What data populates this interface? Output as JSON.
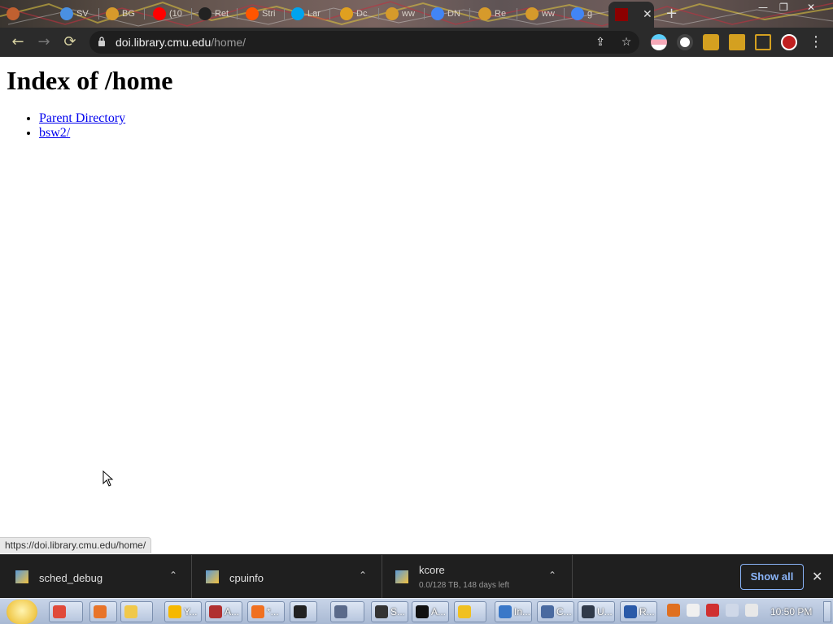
{
  "browser": {
    "tabs": [
      {
        "title": "SV",
        "icon": "circle-blue-icon",
        "color": "#4a90e2"
      },
      {
        "title": "BG",
        "icon": "circle-orange-icon",
        "color": "#d69a2b"
      },
      {
        "title": "(10",
        "icon": "youtube-icon",
        "color": "#ff0000"
      },
      {
        "title": "Ret",
        "icon": "github-icon",
        "color": "#222222"
      },
      {
        "title": "Stri",
        "icon": "soundcloud-icon",
        "color": "#ff5500"
      },
      {
        "title": "Lar",
        "icon": "microsoft-icon",
        "color": "#00a4ef"
      },
      {
        "title": "Dc",
        "icon": "circle-orange-icon",
        "color": "#e0a020"
      },
      {
        "title": "ww",
        "icon": "circle-orange-icon",
        "color": "#d69a2b"
      },
      {
        "title": "DN",
        "icon": "google-icon",
        "color": "#4285f4"
      },
      {
        "title": "Re",
        "icon": "circle-orange-icon",
        "color": "#d69a2b"
      },
      {
        "title": "ww",
        "icon": "circle-orange-icon",
        "color": "#d69a2b"
      },
      {
        "title": "g",
        "icon": "google-icon",
        "color": "#4285f4"
      }
    ],
    "active_tab": {
      "icon": "red-square-icon",
      "close": "✕"
    },
    "new_tab": "+",
    "window_controls": {
      "minimize": "—",
      "maximize": "❐",
      "close": "✕"
    },
    "nav": {
      "back": "←",
      "forward": "→",
      "reload": "⟳"
    },
    "url": {
      "host": "doi.library.cmu.edu",
      "path": "/home/"
    },
    "omnibox_icons": {
      "share": "⇪",
      "bookmark": "☆"
    },
    "menu": "⋮"
  },
  "page": {
    "heading": "Index of /home",
    "links": [
      {
        "label": "Parent Directory"
      },
      {
        "label": "bsw2/"
      }
    ],
    "status_url": "https://doi.library.cmu.edu/home/"
  },
  "downloads": {
    "items": [
      {
        "name": "sched_debug",
        "sub": ""
      },
      {
        "name": "cpuinfo",
        "sub": ""
      },
      {
        "name": "kcore",
        "sub": "0.0/128 TB, 148 days left"
      }
    ],
    "show_all": "Show all",
    "close": "✕",
    "chevron": "⌃"
  },
  "taskbar": {
    "tasks": [
      {
        "label": "",
        "icon": "chrome-icon",
        "color": "#e04a3a"
      },
      {
        "label": "",
        "icon": "firefox-icon",
        "color": "#e8742a"
      },
      {
        "label": "",
        "icon": "folder-icon",
        "color": "#f0c84a"
      },
      {
        "label": "Y...",
        "icon": "smiley-icon",
        "color": "#f6b800"
      },
      {
        "label": "A...",
        "icon": "app-red-icon",
        "color": "#b03030"
      },
      {
        "label": "*...",
        "icon": "search-orange-icon",
        "color": "#f07020"
      },
      {
        "label": "",
        "icon": "7zip-icon",
        "color": "#222222"
      },
      {
        "label": "",
        "icon": "robot-icon",
        "color": "#5a6a8a"
      },
      {
        "label": "S...",
        "icon": "grid-icon",
        "color": "#333333"
      },
      {
        "label": "A...",
        "icon": "terminal-icon",
        "color": "#111111"
      },
      {
        "label": "",
        "icon": "shield-icon",
        "color": "#f0c020"
      },
      {
        "label": "In...",
        "icon": "globe-icon",
        "color": "#3a78c8"
      },
      {
        "label": "C...",
        "icon": "window-icon",
        "color": "#4a6aa0"
      },
      {
        "label": "U...",
        "icon": "circle-dark-icon",
        "color": "#303a4a"
      },
      {
        "label": "R...",
        "icon": "editor-icon",
        "color": "#2a5aa8"
      }
    ],
    "tray_icons": [
      {
        "icon": "search-tray-icon",
        "color": "#e07020"
      },
      {
        "icon": "minus-circle-icon",
        "color": "#f0f0f0"
      },
      {
        "icon": "network-error-icon",
        "color": "#d03030"
      },
      {
        "icon": "monitor-icon",
        "color": "#cfd8e8"
      },
      {
        "icon": "speaker-icon",
        "color": "#e8e8e8"
      }
    ],
    "clock": "10:50 PM"
  }
}
